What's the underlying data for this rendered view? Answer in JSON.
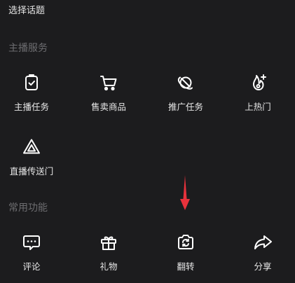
{
  "top": {
    "select_topic": "选择话题"
  },
  "host_services": {
    "title": "主播服务",
    "items": [
      {
        "label": "主播任务",
        "icon": "task-clipboard-icon"
      },
      {
        "label": "售卖商品",
        "icon": "shopping-cart-icon"
      },
      {
        "label": "推广任务",
        "icon": "planet-icon"
      },
      {
        "label": "上热门",
        "icon": "flame-plus-icon"
      },
      {
        "label": "直播传送门",
        "icon": "portal-triangle-icon"
      }
    ]
  },
  "common_functions": {
    "title": "常用功能",
    "items": [
      {
        "label": "评论",
        "icon": "comment-bubble-icon"
      },
      {
        "label": "礼物",
        "icon": "gift-icon"
      },
      {
        "label": "翻转",
        "icon": "flip-camera-icon"
      },
      {
        "label": "分享",
        "icon": "share-arrow-icon"
      }
    ]
  },
  "colors": {
    "background": "#1c1c1e",
    "section_title": "#6d6d70",
    "annotation_arrow": "#e8323c"
  }
}
